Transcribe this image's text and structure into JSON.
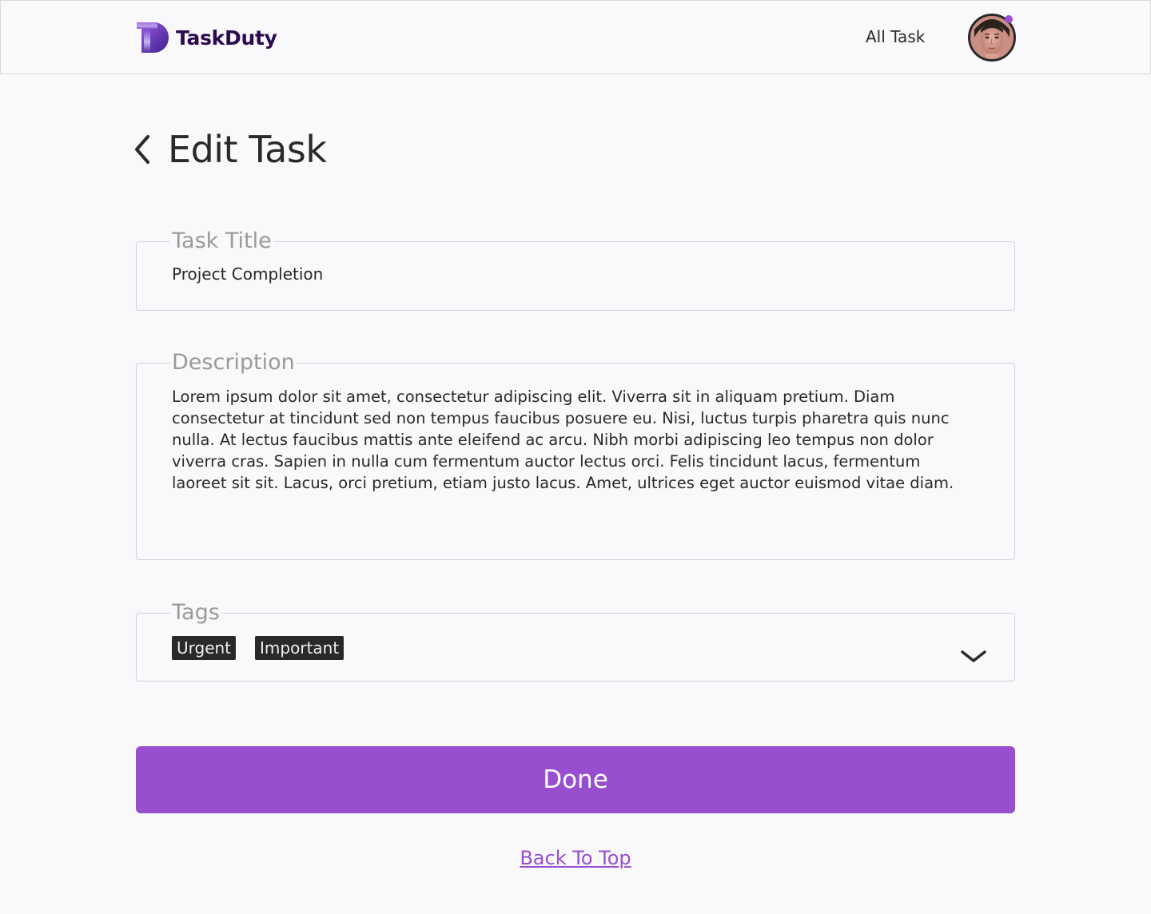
{
  "header": {
    "brand_name": "TaskDuty",
    "nav_all_task": "All Task"
  },
  "page": {
    "title": "Edit Task"
  },
  "form": {
    "task_title": {
      "label": "Task Title",
      "value": "Project Completion"
    },
    "description": {
      "label": "Description",
      "value": "Lorem ipsum dolor sit amet, consectetur adipiscing elit. Viverra sit in aliquam pretium. Diam consectetur at tincidunt sed non tempus faucibus posuere eu. Nisi, luctus turpis pharetra quis nunc nulla. At lectus faucibus mattis ante eleifend ac arcu. Nibh morbi adipiscing leo tempus non dolor viverra cras. Sapien in nulla cum fermentum auctor lectus orci. Felis tincidunt lacus, fermentum laoreet sit sit. Lacus, orci pretium, etiam justo lacus. Amet, ultrices eget auctor euismod vitae diam."
    },
    "tags": {
      "label": "Tags",
      "selected": [
        "Urgent",
        "Important"
      ]
    },
    "done_label": "Done"
  },
  "footer": {
    "back_to_top": "Back To Top"
  },
  "icons": {
    "logo": "taskduty-logo-icon",
    "back": "chevron-left-icon",
    "dropdown": "chevron-down-icon",
    "avatar": "user-avatar"
  },
  "colors": {
    "accent": "#974fd0",
    "brand_text": "#2b0a4f",
    "tag_bg": "#292929",
    "notification_dot": "#9b4fd6"
  }
}
